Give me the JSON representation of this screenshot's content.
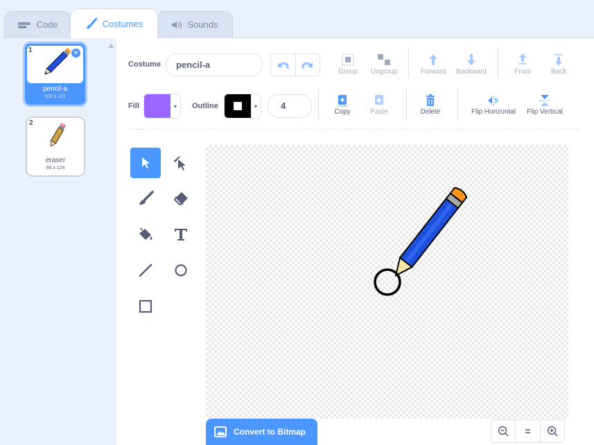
{
  "tabs": [
    {
      "label": "Code",
      "icon": "code-icon"
    },
    {
      "label": "Costumes",
      "icon": "brush-icon"
    },
    {
      "label": "Sounds",
      "icon": "speaker-icon"
    }
  ],
  "costumes": [
    {
      "number": "1",
      "name": "pencil-a",
      "size": "102 x 121",
      "selected": true
    },
    {
      "number": "2",
      "name": "eraser",
      "size": "94 x 124",
      "selected": false
    }
  ],
  "toolbar": {
    "costume_label": "Costume",
    "costume_name": "pencil-a",
    "group": "Group",
    "ungroup": "Ungroup",
    "forward": "Forward",
    "backward": "Backward",
    "front": "Front",
    "back": "Back",
    "fill_label": "Fill",
    "fill_color": "#9966ff",
    "outline_label": "Outline",
    "outline_color": "#000000",
    "outline_width": "4",
    "copy": "Copy",
    "paste": "Paste",
    "delete": "Delete",
    "flip_horizontal": "Flip Horizontal",
    "flip_vertical": "Flip Vertical"
  },
  "tools": [
    "select",
    "reshape",
    "brush",
    "eraser",
    "fill",
    "text",
    "line",
    "circle",
    "rectangle"
  ],
  "bottom": {
    "convert_label": "Convert to Bitmap",
    "zoom_out": "zoom-out-icon",
    "zoom_reset": "=",
    "zoom_in": "zoom-in-icon"
  },
  "colors": {
    "accent": "#4c97ff",
    "text": "#575e75",
    "delete": "#4c97ff"
  }
}
